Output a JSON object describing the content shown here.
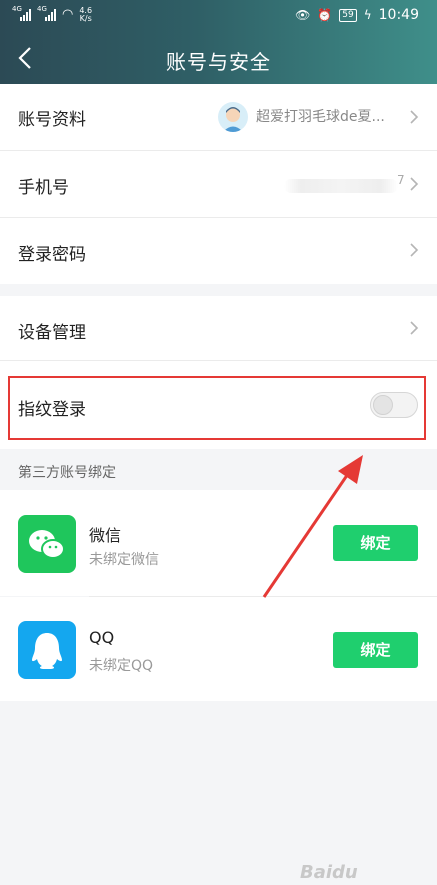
{
  "status_bar": {
    "sig1": "4G",
    "sig2": "4G",
    "speed_value": "4.6",
    "speed_unit": "K/s",
    "battery": "59",
    "time": "10:49"
  },
  "header": {
    "back_icon": "chevron-left-icon",
    "title": "账号与安全"
  },
  "rows": {
    "profile": {
      "label": "账号资料",
      "name": "超爱打羽毛球de夏..."
    },
    "phone": {
      "label": "手机号",
      "value_suffix": "7"
    },
    "password": {
      "label": "登录密码"
    },
    "device": {
      "label": "设备管理"
    },
    "fingerprint": {
      "label": "指纹登录",
      "enabled": false
    }
  },
  "third_party": {
    "section_title": "第三方账号绑定",
    "accounts": [
      {
        "name": "微信",
        "status": "未绑定微信",
        "button": "绑定",
        "icon": "wechat-icon",
        "color": "#1fc65c"
      },
      {
        "name": "QQ",
        "status": "未绑定QQ",
        "button": "绑定",
        "icon": "qq-icon",
        "color": "#14a7ef"
      }
    ]
  },
  "watermark": "Baidu",
  "colors": {
    "highlight": "#e53935",
    "button": "#1fcf6e",
    "arrow": "#e53935"
  }
}
